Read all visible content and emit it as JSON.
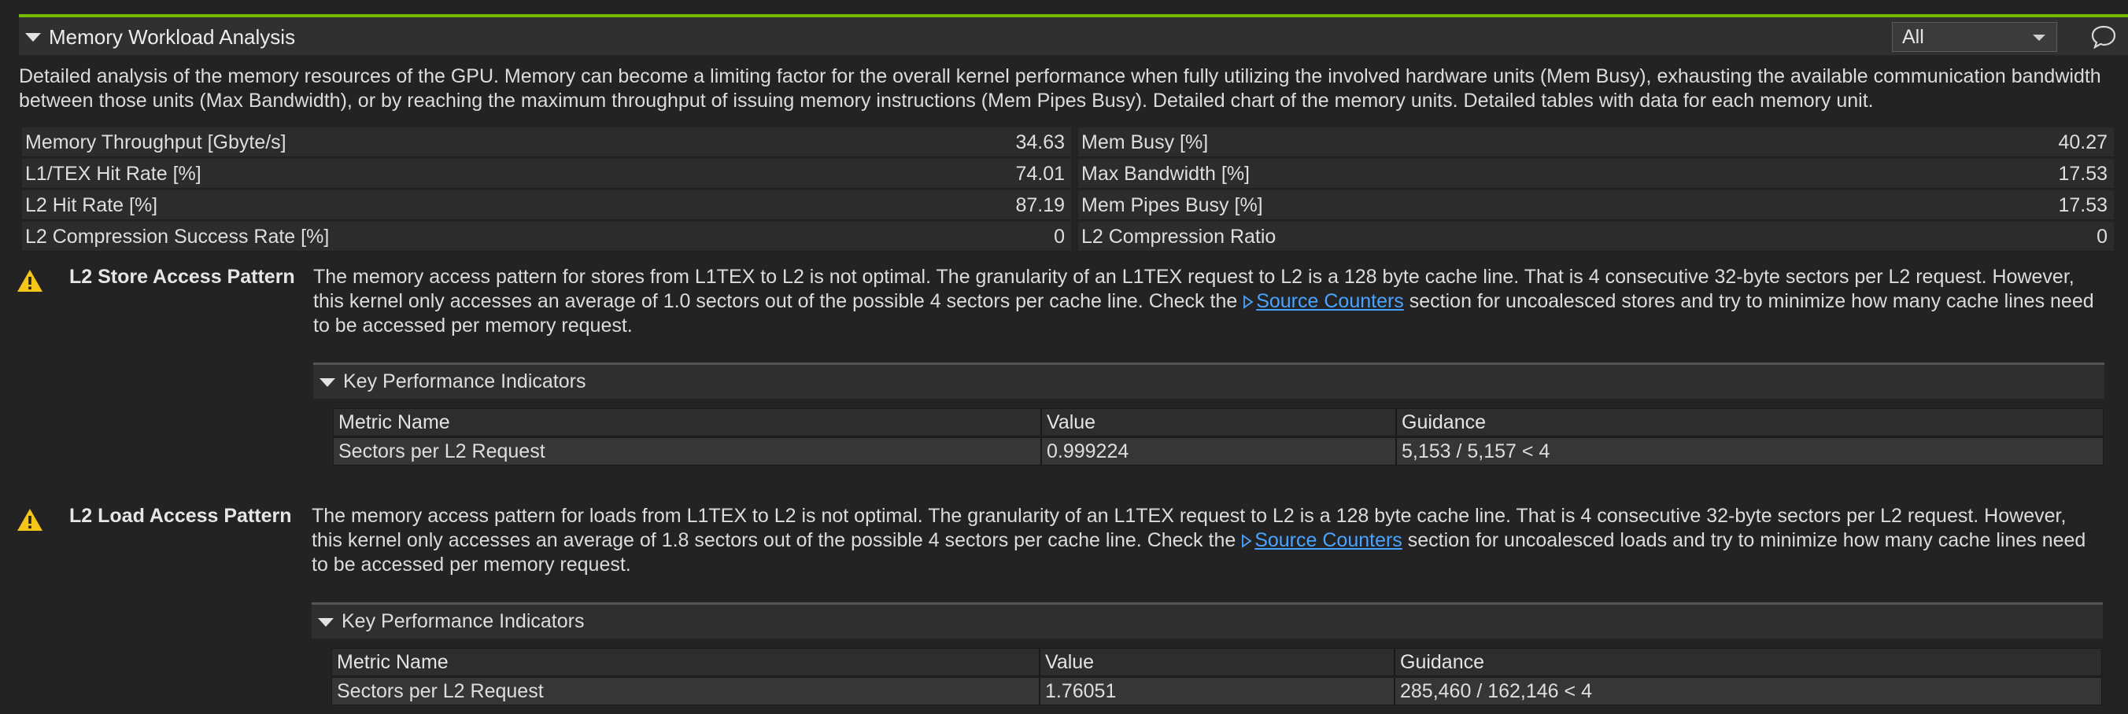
{
  "section": {
    "title": "Memory Workload Analysis",
    "filter_value": "All",
    "description": "Detailed analysis of the memory resources of the GPU. Memory can become a limiting factor for the overall kernel performance when fully utilizing the involved hardware units (Mem Busy), exhausting the available communication bandwidth between those units (Max Bandwidth), or by reaching the maximum throughput of issuing memory instructions (Mem Pipes Busy). Detailed chart of the memory units. Detailed tables with data for each memory unit."
  },
  "metrics": [
    {
      "left_label": "Memory Throughput [Gbyte/s]",
      "left_value": "34.63",
      "right_label": "Mem Busy [%]",
      "right_value": "40.27"
    },
    {
      "left_label": "L1/TEX Hit Rate [%]",
      "left_value": "74.01",
      "right_label": "Max Bandwidth [%]",
      "right_value": "17.53"
    },
    {
      "left_label": "L2 Hit Rate [%]",
      "left_value": "87.19",
      "right_label": "Mem Pipes Busy [%]",
      "right_value": "17.53"
    },
    {
      "left_label": "L2 Compression Success Rate [%]",
      "left_value": "0",
      "right_label": "L2 Compression Ratio",
      "right_value": "0"
    }
  ],
  "rules": [
    {
      "name": "L2 Store Access Pattern",
      "text_before": "The memory access pattern for stores from L1TEX to L2 is not optimal. The granularity of an L1TEX request to L2 is a 128 byte cache line. That is 4 consecutive 32-byte sectors per L2 request. However, this kernel only accesses an average of 1.0 sectors out of the possible 4 sectors per cache line. Check the ",
      "link_text": "Source Counters",
      "text_after": " section for uncoalesced stores and try to minimize how many cache lines need to be accessed per memory request.",
      "kpi_title": "Key Performance Indicators",
      "kpi_headers": [
        "Metric Name",
        "Value",
        "Guidance"
      ],
      "kpi_row": [
        "Sectors per L2 Request",
        "0.999224",
        "5,153 / 5,157 < 4"
      ]
    },
    {
      "name": "L2 Load Access Pattern",
      "text_before": "The memory access pattern for loads from L1TEX to L2 is not optimal. The granularity of an L1TEX request to L2 is a 128 byte cache line. That is 4 consecutive 32-byte sectors per L2 request. However, this kernel only accesses an average of 1.8 sectors out of the possible 4 sectors per cache line. Check the ",
      "link_text": "Source Counters",
      "text_after": " section for uncoalesced loads and try to minimize how many cache lines need to be accessed per memory request.",
      "kpi_title": "Key Performance Indicators",
      "kpi_headers": [
        "Metric Name",
        "Value",
        "Guidance"
      ],
      "kpi_row": [
        "Sectors per L2 Request",
        "1.76051",
        "285,460 / 162,146 < 4"
      ]
    }
  ],
  "colors": {
    "accent": "#76b900",
    "link": "#4aa3ff",
    "warning": "#f5c518"
  },
  "icons": {
    "collapse": "triangle-down-icon",
    "comment": "comment-icon",
    "warning": "warning-icon",
    "link": "play-icon"
  }
}
